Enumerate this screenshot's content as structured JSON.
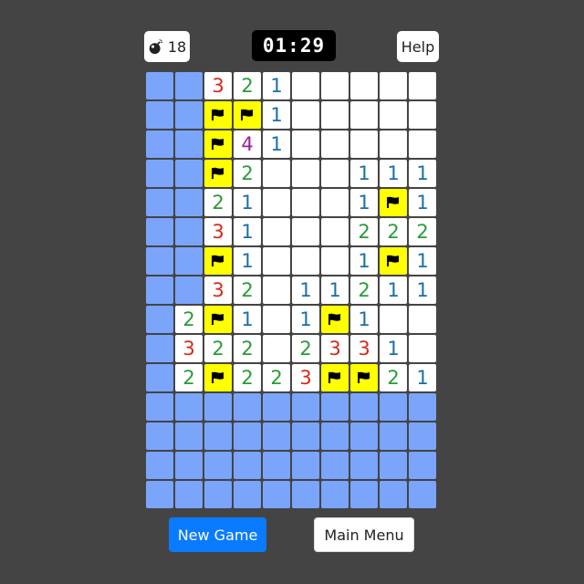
{
  "header": {
    "mines_remaining": "18",
    "mine_icon": "bomb-icon",
    "timer": "01:29",
    "help_label": "Help"
  },
  "board": {
    "columns": 10,
    "rows": 15,
    "legend": {
      "H": "hidden",
      "F": "flag",
      ".": "open-empty",
      "1-8": "open-number"
    },
    "grid": [
      "HH321.....",
      "HHFF1.....",
      "HHF41.....",
      "HHF2...111",
      "HH21...1F1",
      "HH31...222",
      "HHF1...1F1",
      "HH32.11211",
      "H2F1.1F1..",
      "H322.2331.",
      "H2F223FF21",
      "HHHHHHHHHH",
      "HHHHHHHHHH",
      "HHHHHHHHHH",
      "HHHHHHHHHH"
    ],
    "colors": {
      "hidden": "#7aa5fb",
      "open": "#ffffff",
      "flag": "#ffff00",
      "n1": "#1a6fa8",
      "n2": "#2a9b3a",
      "n3": "#d42a1c",
      "n4": "#9a1f9a"
    }
  },
  "footer": {
    "new_game_label": "New Game",
    "main_menu_label": "Main Menu"
  }
}
